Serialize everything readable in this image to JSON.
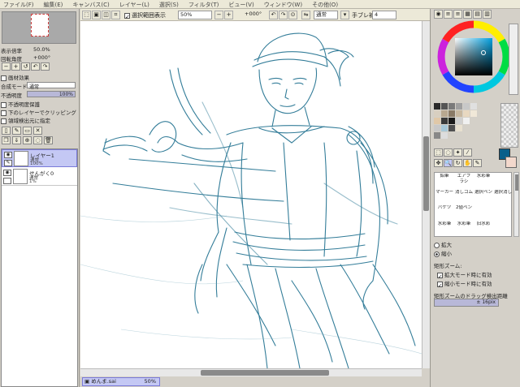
{
  "menu": [
    "ファイル(F)",
    "編集(E)",
    "キャンバス(C)",
    "レイヤー(L)",
    "選択(S)",
    "フィルタ(T)",
    "ビュー(V)",
    "ウィンドウ(W)",
    "その他(O)"
  ],
  "left": {
    "zoom_label": "表示倍率",
    "zoom_value": "50.0%",
    "rotation_label": "回転角度",
    "rotation_value": "+000°",
    "effects_label": "画材効果",
    "blend_label": "合成モード",
    "blend_value": "通常",
    "opacity_label": "不透明度",
    "opacity_value": "100%",
    "preserve_opacity": "不透明度保護",
    "clip_lower": "下のレイヤーでクリッピング",
    "selection_source": "領域検出元に指定",
    "layers": [
      {
        "name": "レイヤー1",
        "mode": "通常",
        "opacity": "100%",
        "selected": true
      },
      {
        "name": "せんがく0",
        "mode": "通常",
        "opacity": "1%",
        "selected": false
      }
    ]
  },
  "toolbar": {
    "show_selection_label": "選択範囲表示",
    "zoom": "50%",
    "angle": "+000°",
    "blend": "通常",
    "stabilizer_label": "手ブレ補正",
    "stabilizer_value": "4"
  },
  "doc": {
    "name": "めんま.sai",
    "zoom": "50%"
  },
  "right": {
    "zoom_in_label": "拡大",
    "zoom_out_label": "縮小",
    "rect_zoom_label": "矩形ズーム:",
    "rect_zoom_in": "拡大モード時に有効",
    "rect_zoom_out": "縮小モード時に有効",
    "drag_label": "矩形ズームのドラッグ検出距離",
    "drag_value": "± 16pix",
    "main_color": "#0a5f8a",
    "sub_color": "#f3d8cc",
    "tools": [
      "鉛筆",
      "エアブラシ",
      "水彩筆",
      "マーカー",
      "消しゴム",
      "選択ペン",
      "選択消し",
      "バケツ",
      "2値ペン",
      "水彩筆",
      "水彩筆",
      "旧水彩"
    ]
  }
}
